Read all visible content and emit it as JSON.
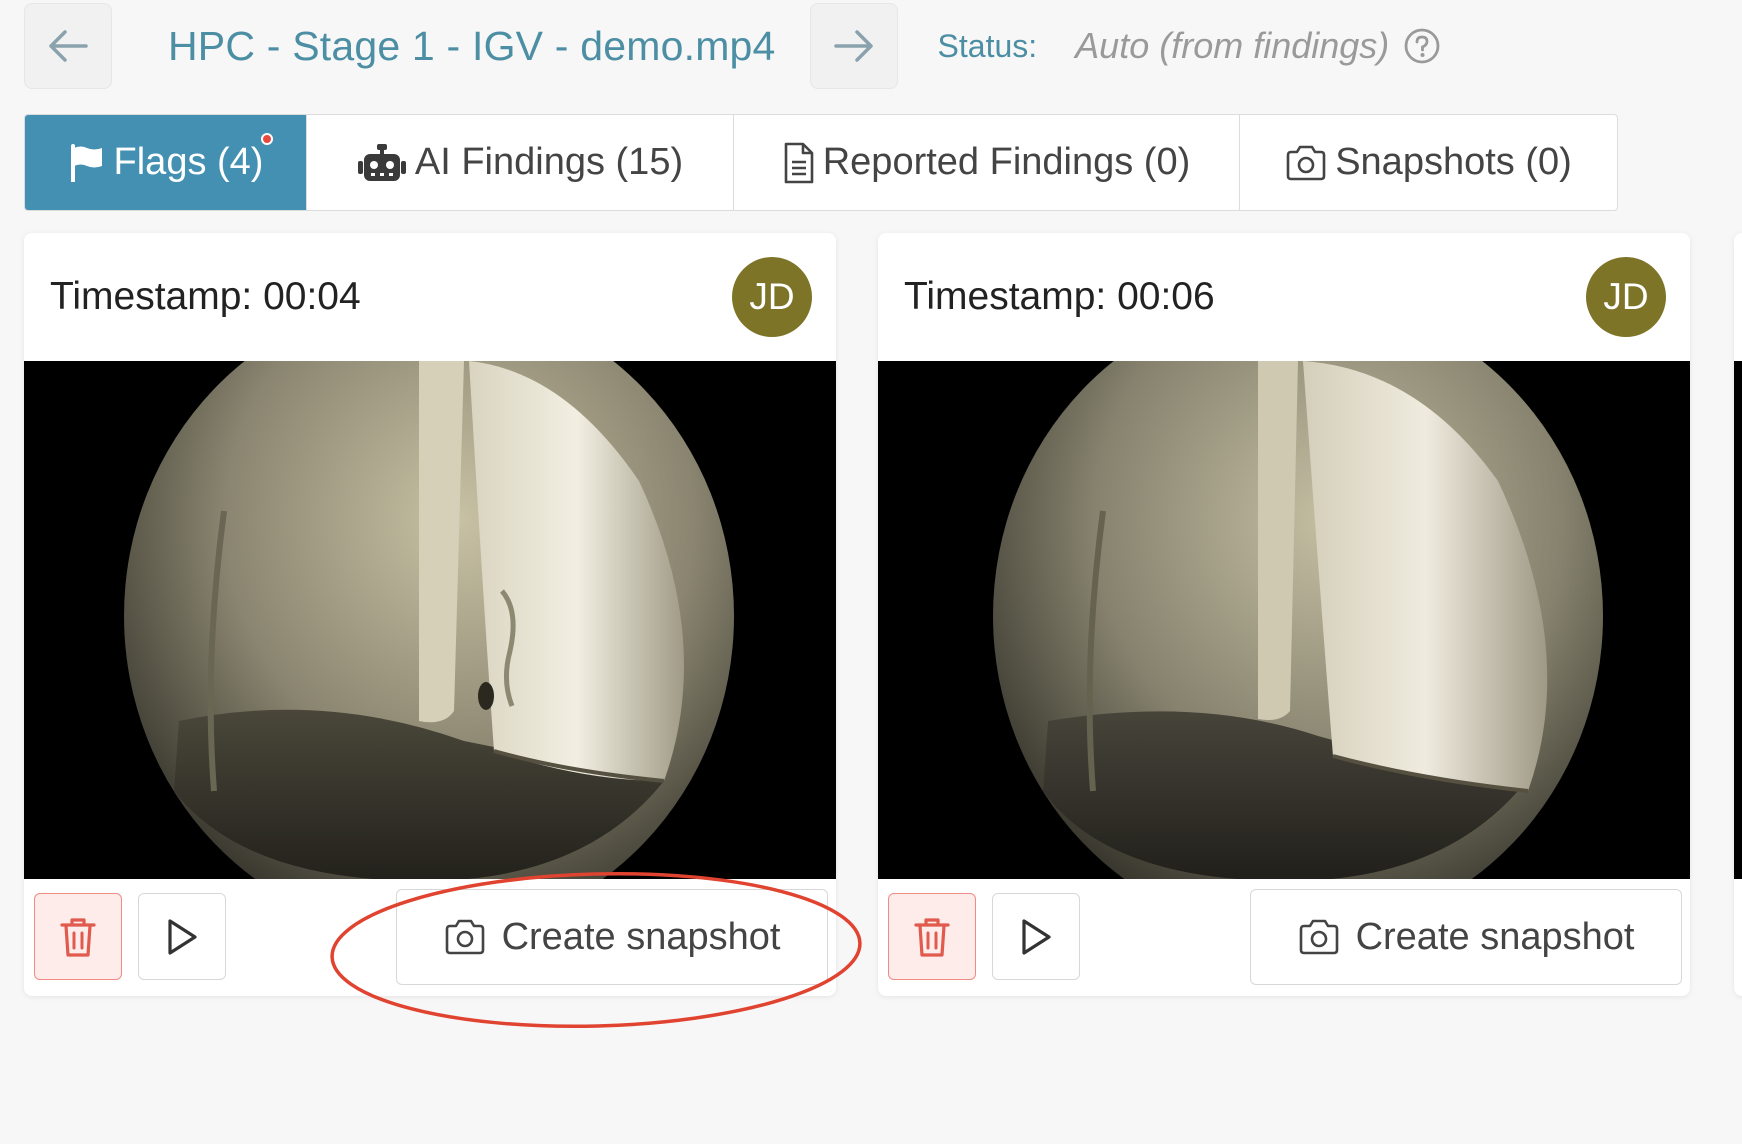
{
  "header": {
    "title": "HPC - Stage 1 - IGV - demo.mp4",
    "status_label": "Status:",
    "status_value": "Auto (from findings)"
  },
  "tabs": [
    {
      "label": "Flags (4)",
      "icon": "flag-icon",
      "active": true,
      "has_notification": true
    },
    {
      "label": "AI Findings (15)",
      "icon": "robot-icon",
      "active": false
    },
    {
      "label": "Reported Findings (0)",
      "icon": "document-icon",
      "active": false
    },
    {
      "label": "Snapshots (0)",
      "icon": "camera-icon",
      "active": false
    }
  ],
  "cards": [
    {
      "timestamp": "Timestamp: 00:04",
      "avatar": "JD",
      "snapshot_label": "Create snapshot"
    },
    {
      "timestamp": "Timestamp: 00:06",
      "avatar": "JD",
      "snapshot_label": "Create snapshot"
    }
  ],
  "colors": {
    "accent": "#4390b2",
    "title": "#4c8ea4",
    "avatar": "#7d7428",
    "danger": "#e05a4e",
    "annotation": "#e0432f"
  }
}
